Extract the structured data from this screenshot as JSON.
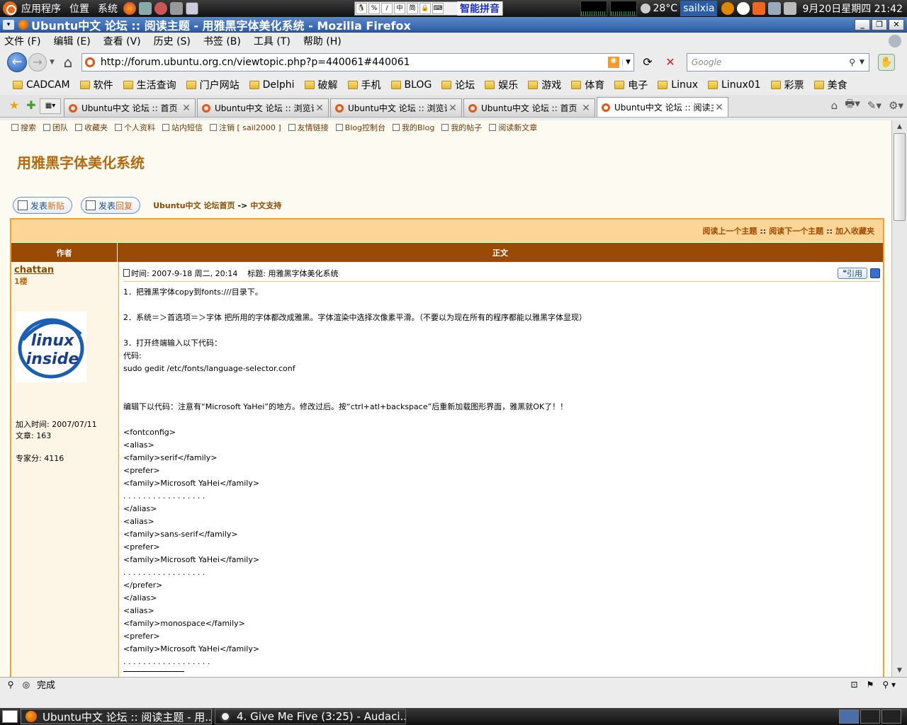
{
  "top_panel": {
    "menus": [
      "应用程序",
      "位置",
      "系统"
    ],
    "ime": {
      "label": "智能拼音"
    },
    "temperature": "28°C",
    "username": "sailxia",
    "datetime": "9月20日星期四 21:42"
  },
  "window": {
    "title": "Ubuntu中文 论坛 :: 阅读主题 - 用雅黑字体美化系统 - Mozilla Firefox"
  },
  "menubar": [
    "文件 (F)",
    "编辑 (E)",
    "查看 (V)",
    "历史 (S)",
    "书签 (B)",
    "工具 (T)",
    "帮助 (H)"
  ],
  "navbar": {
    "url": "http://forum.ubuntu.org.cn/viewtopic.php?p=440061#440061",
    "search_placeholder": "Google"
  },
  "bookmarks": [
    "CADCAM",
    "软件",
    "生活查询",
    "门户网站",
    "Delphi",
    "破解",
    "手机",
    "BLOG",
    "论坛",
    "娱乐",
    "游戏",
    "体育",
    "电子",
    "Linux",
    "Linux01",
    "彩票",
    "美食"
  ],
  "tabs": [
    {
      "title": "Ubuntu中文 论坛 :: 首页",
      "active": false
    },
    {
      "title": "Ubuntu中文 论坛 :: 浏览论...",
      "active": false
    },
    {
      "title": "Ubuntu中文 论坛 :: 浏览论...",
      "active": false
    },
    {
      "title": "Ubuntu中文 论坛 :: 首页",
      "active": false
    },
    {
      "title": "Ubuntu中文 论坛 :: 阅读主...",
      "active": true
    }
  ],
  "forum_nav": [
    "搜索",
    "团队",
    "收藏夹",
    "个人资料",
    "站内短信",
    "注销 [ sail2000 ]",
    "友情链接",
    "Blog控制台",
    "我的Blog",
    "我的帖子",
    "阅读新文章"
  ],
  "topic": {
    "title": "用雅黑字体美化系统",
    "new_post_btn": {
      "a": "发表",
      "b": "新贴"
    },
    "reply_btn": {
      "a": "发表",
      "b": "回复"
    },
    "breadcrumb": {
      "home": "Ubuntu中文 论坛首页",
      "sep": "->",
      "forum": "中文支持"
    },
    "topnav": {
      "prev": "阅读上一个主题",
      "next": "阅读下一个主题",
      "fav": "加入收藏夹",
      "sep": "::"
    },
    "col_author": "作者",
    "col_body": "正文"
  },
  "post": {
    "author": "chattan",
    "floor": "1楼",
    "avatar_text": {
      "line1": "linux",
      "line2": "inside"
    },
    "joined": "加入时间: 2007/07/11",
    "posts": "文章: 163",
    "score": "专家分: 4116",
    "header": "时间: 2007-9-18 周二, 20:14    标题: 用雅黑字体美化系统",
    "quote_label": "引用",
    "lines": [
      "1．把雅黑字体copy到fonts:///目录下。",
      "",
      "2．系统＝＞首选项＝＞字体 把所用的字体都改成雅黑。字体渲染中选择次像素平滑。（不要以为现在所有的程序都能以雅黑字体显现）",
      "",
      "3．打开终端输入以下代码：",
      "代码:",
      "sudo gedit /etc/fonts/language-selector.conf",
      "",
      "",
      "编辑下以代码：注意有“Microsoft YaHei”的地方。修改过后。按“ctrl+atl+backspace”后重新加载图形界面，雅黑就OK了！！",
      "",
      "<fontconfig>",
      "<alias>",
      "<family>serif</family>",
      "<prefer>",
      "<family>Microsoft YaHei</family>",
      ". . . . . . . . . . . . . . . . .",
      "</alias>",
      "<alias>",
      "<family>sans-serif</family>",
      "<prefer>",
      "<family>Microsoft YaHei</family>",
      ". . . . . . . . . . . . . . . . .",
      "</prefer>",
      "</alias>",
      "<alias>",
      "<family>monospace</family>",
      "<prefer>",
      "<family>Microsoft YaHei</family>",
      ". . . . . . . . . . . . . . . . . ."
    ]
  },
  "statusbar": {
    "text": "完成"
  },
  "taskbar": [
    {
      "title": "Ubuntu中文 论坛 :: 阅读主题 - 用...",
      "active": true
    },
    {
      "title": "4. Give Me Five (3:25) - Audaci...",
      "active": false
    }
  ]
}
